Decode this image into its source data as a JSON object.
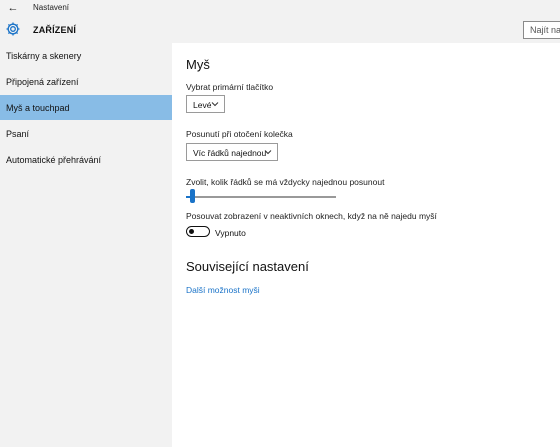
{
  "window": {
    "title": "Nastavení",
    "back_icon": "arrow-left-icon"
  },
  "header": {
    "title": "ZAŘÍZENÍ",
    "icon": "gear-icon",
    "search_placeholder": "Najít nastavení"
  },
  "sidebar": {
    "items": [
      {
        "label": "Tiskárny a skenery",
        "active": false
      },
      {
        "label": "Připojená zařízení",
        "active": false
      },
      {
        "label": "Myš a touchpad",
        "active": true
      },
      {
        "label": "Psaní",
        "active": false
      },
      {
        "label": "Automatické přehrávání",
        "active": false
      }
    ]
  },
  "main": {
    "section_title": "Myš",
    "primary_button": {
      "label": "Vybrat primární tlačítko",
      "value": "Levé"
    },
    "scroll_wheel": {
      "label": "Posunutí při otočení kolečka",
      "value": "Víc řádků najednou"
    },
    "lines_slider": {
      "label": "Zvolit, kolik řádků se má vždycky najednou posunout",
      "level": 0.02
    },
    "inactive_scroll": {
      "label": "Posouvat zobrazení v neaktivních oknech, když na ně najedu myší",
      "state": "Vypnuto"
    },
    "related_title": "Související nastavení",
    "related_link": "Další možnost myši"
  },
  "colors": {
    "accent": "#1a73c8",
    "active_nav": "#88bce6",
    "chrome": "#f2f2f2"
  }
}
